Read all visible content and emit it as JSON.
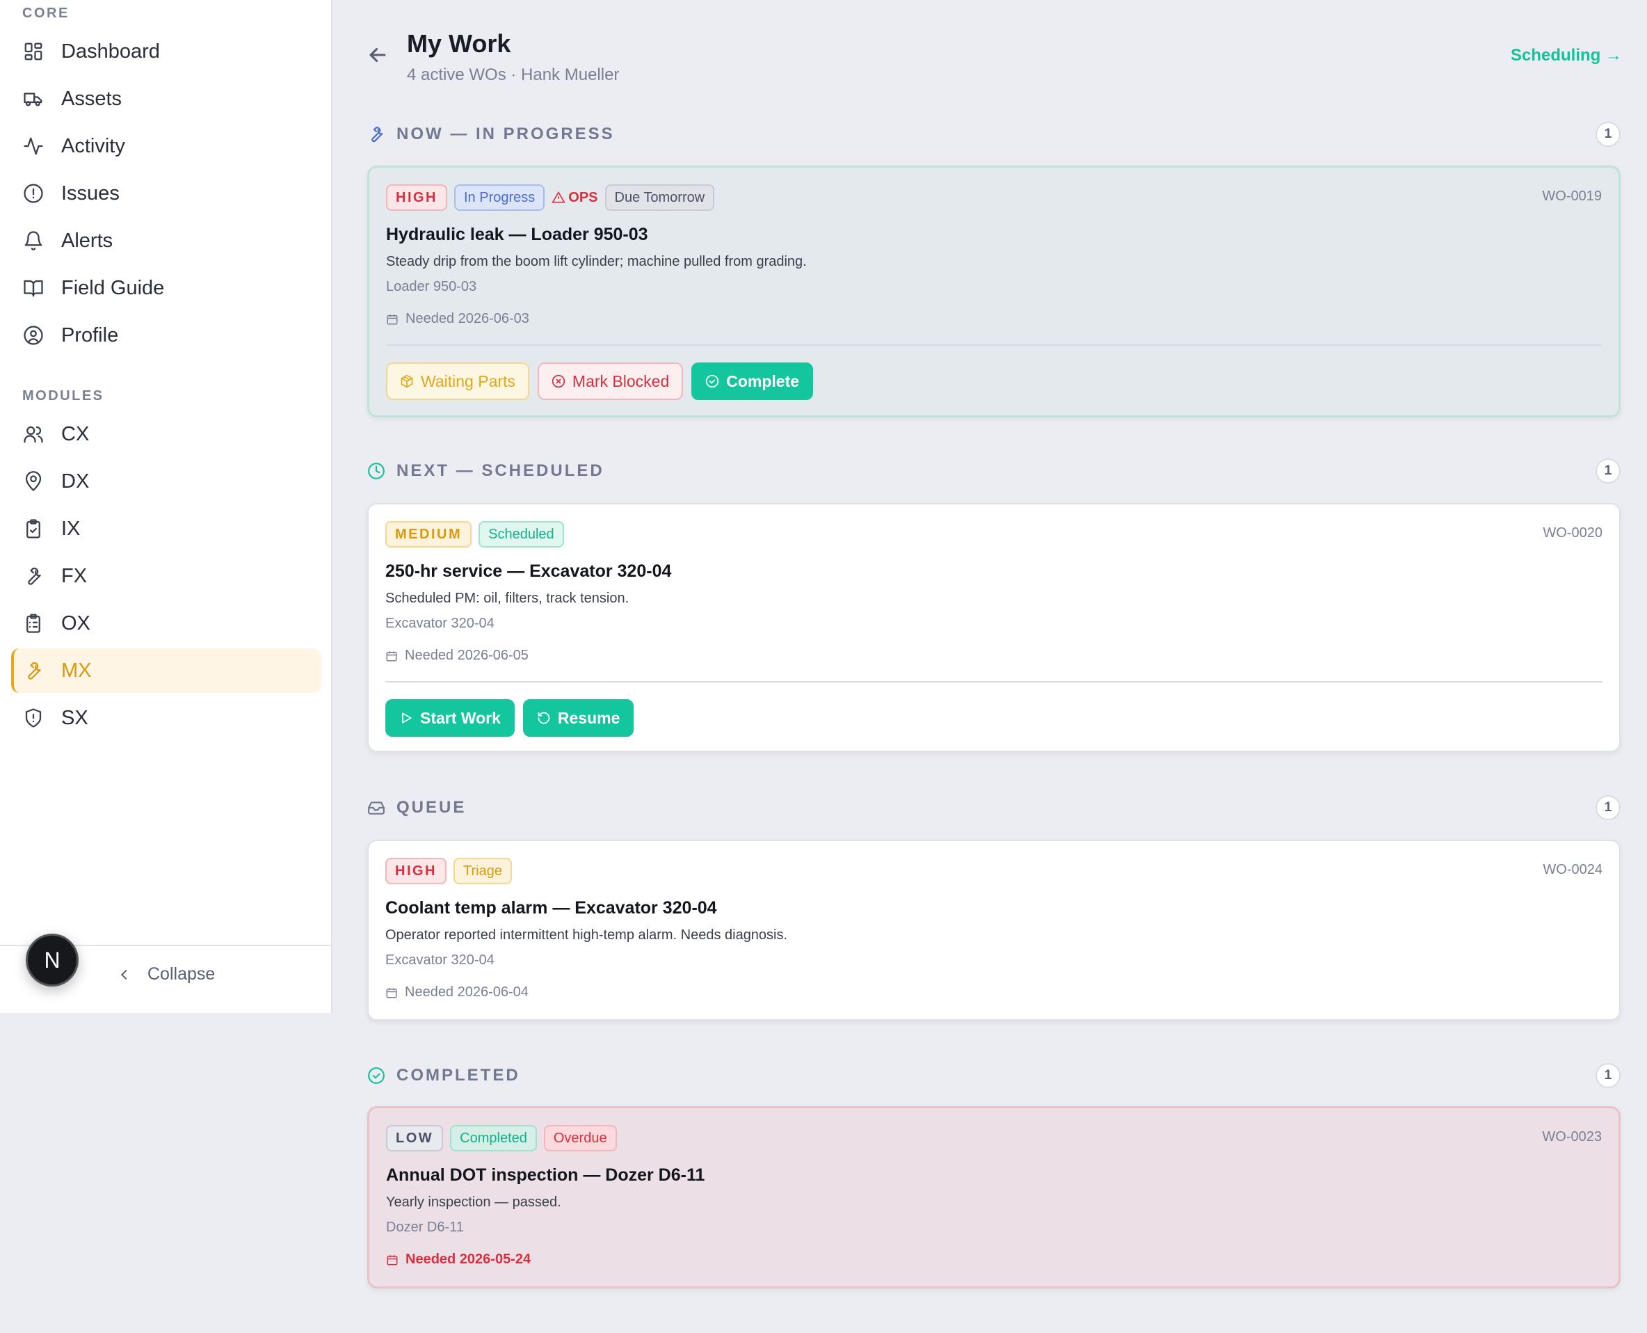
{
  "sidebar": {
    "core_label": "CORE",
    "core_items": [
      {
        "label": "Dashboard",
        "icon": "dashboard-icon"
      },
      {
        "label": "Assets",
        "icon": "truck-icon"
      },
      {
        "label": "Activity",
        "icon": "activity-icon"
      },
      {
        "label": "Issues",
        "icon": "alert-circle-icon"
      },
      {
        "label": "Alerts",
        "icon": "bell-icon"
      },
      {
        "label": "Field Guide",
        "icon": "book-icon"
      },
      {
        "label": "Profile",
        "icon": "user-circle-icon"
      }
    ],
    "modules_label": "MODULES",
    "module_items": [
      {
        "label": "CX",
        "icon": "users-icon"
      },
      {
        "label": "DX",
        "icon": "map-pin-icon"
      },
      {
        "label": "IX",
        "icon": "clipboard-check-icon"
      },
      {
        "label": "FX",
        "icon": "wrench-icon"
      },
      {
        "label": "OX",
        "icon": "clipboard-list-icon"
      },
      {
        "label": "MX",
        "icon": "wrench-icon",
        "active": true
      },
      {
        "label": "SX",
        "icon": "shield-alert-icon"
      }
    ],
    "collapse_label": "Collapse",
    "badge_letter": "N"
  },
  "header": {
    "title": "My Work",
    "subtitle": "4 active WOs · Hank Mueller",
    "scheduling_link": "Scheduling →"
  },
  "sections": {
    "now": {
      "title": "NOW — IN PROGRESS",
      "count": "1"
    },
    "next": {
      "title": "NEXT — SCHEDULED",
      "count": "1"
    },
    "queue": {
      "title": "QUEUE",
      "count": "1"
    },
    "completed": {
      "title": "COMPLETED",
      "count": "1"
    }
  },
  "cards": {
    "wo19": {
      "priority": "HIGH",
      "status": "In Progress",
      "flag": "OPS",
      "due": "Due Tomorrow",
      "id": "WO-0019",
      "title": "Hydraulic leak — Loader 950-03",
      "description": "Steady drip from the boom lift cylinder; machine pulled from grading.",
      "asset": "Loader 950-03",
      "needed": "Needed 2026-06-03",
      "actions": {
        "waiting": "Waiting Parts",
        "blocked": "Mark Blocked",
        "complete": "Complete"
      }
    },
    "wo20": {
      "priority": "MEDIUM",
      "status": "Scheduled",
      "id": "WO-0020",
      "title": "250-hr service — Excavator 320-04",
      "description": "Scheduled PM: oil, filters, track tension.",
      "asset": "Excavator 320-04",
      "needed": "Needed 2026-06-05",
      "actions": {
        "start": "Start Work",
        "resume": "Resume"
      }
    },
    "wo24": {
      "priority": "HIGH",
      "status": "Triage",
      "id": "WO-0024",
      "title": "Coolant temp alarm — Excavator 320-04",
      "description": "Operator reported intermittent high-temp alarm. Needs diagnosis.",
      "asset": "Excavator 320-04",
      "needed": "Needed 2026-06-04"
    },
    "wo23": {
      "priority": "LOW",
      "status": "Completed",
      "flag": "Overdue",
      "id": "WO-0023",
      "title": "Annual DOT inspection — Dozer D6-11",
      "description": "Yearly inspection — passed.",
      "asset": "Dozer D6-11",
      "needed": "Needed 2026-05-24"
    }
  },
  "colors": {
    "accent_green": "#14c69d",
    "accent_amber": "#e7a91a",
    "danger_red": "#d63040"
  }
}
